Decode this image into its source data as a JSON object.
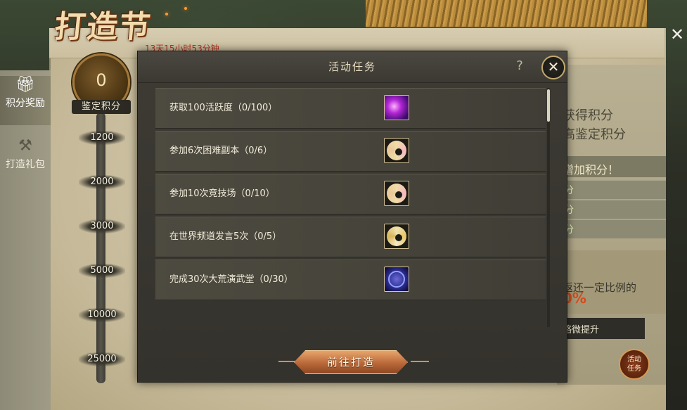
{
  "festival": {
    "title": "打造节",
    "countdown": "13天15小时53分钟"
  },
  "side_nav": [
    {
      "label": "积分奖励",
      "icon": "gift-icon"
    },
    {
      "label": "打造礼包",
      "icon": "anvil-icon"
    }
  ],
  "score": {
    "value": "0",
    "label": "鉴定积分",
    "milestones": [
      "1200",
      "2000",
      "3000",
      "5000",
      "10000",
      "25000"
    ]
  },
  "right_panel": {
    "line1": "获得积分",
    "line2": "高鉴定积分",
    "band": "增加积分！",
    "rows": [
      "分",
      "分",
      "分"
    ],
    "refund_text": "返还一定比例的",
    "refund_percent": "0%",
    "note": "略微提升",
    "activity_button_line1": "活动",
    "activity_button_line2": "任务"
  },
  "modal": {
    "title": "活动任务",
    "help": "?",
    "close": "✕",
    "tasks": [
      {
        "label": "获取100活跃度（0/100）",
        "icon": "purple-orb-icon"
      },
      {
        "label": "参加6次困难副本（0/6）",
        "icon": "pink-disc-icon"
      },
      {
        "label": "参加10次竞技场（0/10）",
        "icon": "pink-disc-icon"
      },
      {
        "label": "在世界频道发言5次（0/5）",
        "icon": "gold-disc-icon"
      },
      {
        "label": "完成30次大荒演武堂（0/30）",
        "icon": "blue-orb-icon"
      }
    ],
    "go_button": "前往打造"
  },
  "colors": {
    "accent": "#e7a56b",
    "modal_bg": "#3d3b34",
    "countdown": "#b8321d"
  }
}
